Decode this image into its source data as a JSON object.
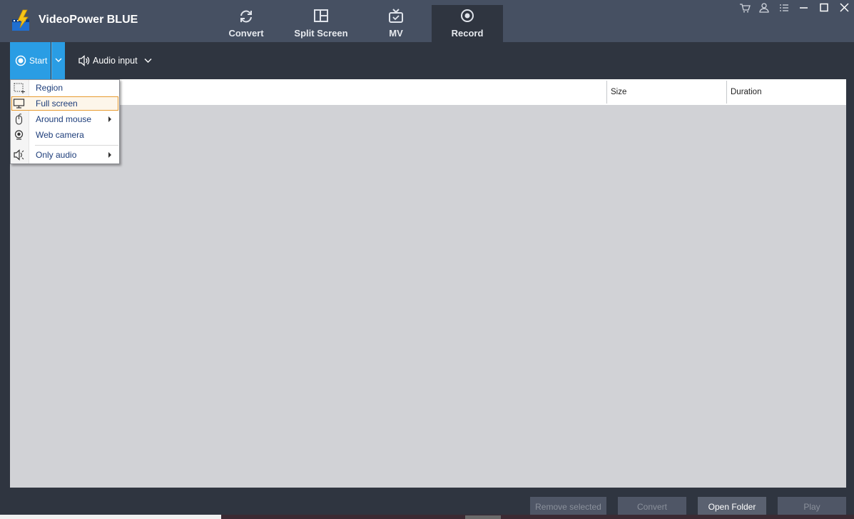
{
  "app": {
    "title": "VideoPower BLUE"
  },
  "tabs": [
    {
      "label": "Convert",
      "icon": "refresh-icon",
      "active": false
    },
    {
      "label": "Split Screen",
      "icon": "split-screen-icon",
      "active": false
    },
    {
      "label": "MV",
      "icon": "tv-icon",
      "active": false
    },
    {
      "label": "Record",
      "icon": "record-icon",
      "active": true
    }
  ],
  "window_controls": [
    "cart-icon",
    "user-icon",
    "menu-list-icon",
    "minimize-icon",
    "maximize-icon",
    "close-icon"
  ],
  "toolbar": {
    "start_label": "Start",
    "audio_label": "Audio input"
  },
  "table": {
    "columns": [
      "",
      "Size",
      "Duration"
    ],
    "rows": []
  },
  "menu": {
    "items": [
      {
        "label": "Region",
        "icon": "region-select-icon",
        "submenu": false,
        "selected": false
      },
      {
        "label": "Full screen",
        "icon": "monitor-icon",
        "submenu": false,
        "selected": true
      },
      {
        "label": "Around mouse",
        "icon": "mouse-icon",
        "submenu": true,
        "selected": false
      },
      {
        "label": "Web camera",
        "icon": "webcam-icon",
        "submenu": false,
        "selected": false
      },
      {
        "label": "Only audio",
        "icon": "speaker-icon",
        "submenu": true,
        "selected": false
      }
    ]
  },
  "bottom": {
    "remove_selected": "Remove selected",
    "convert": "Convert",
    "open_folder": "Open Folder",
    "play": "Play"
  },
  "colors": {
    "titlebar": "#465062",
    "body": "#2f3540",
    "accent": "#2a9de4",
    "menu_highlight": "#e89b2f",
    "menu_text": "#1d3d7a"
  }
}
